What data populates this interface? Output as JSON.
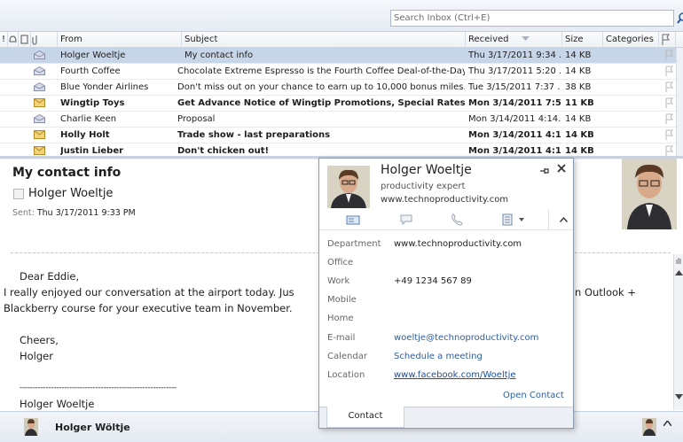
{
  "search": {
    "placeholder": "Search Inbox (Ctrl+E)"
  },
  "columns": {
    "importance": "!",
    "from": "From",
    "subject": "Subject",
    "received": "Received",
    "size": "Size",
    "categories": "Categories"
  },
  "messages": [
    {
      "from": "Holger Woeltje",
      "subject": "My contact info",
      "received": "Thu 3/17/2011 9:34 ...",
      "size": "14 KB",
      "unread": false,
      "selected": true
    },
    {
      "from": "Fourth Coffee",
      "subject": "Chocolate Extreme Espresso is the Fourth Coffee Deal-of-the-Day",
      "received": "Thu 3/17/2011 5:20 ...",
      "size": "14 KB",
      "unread": false,
      "selected": false
    },
    {
      "from": "Blue Yonder Airlines",
      "subject": "Don't miss out on your chance to earn up to 10,000 bonus miles.",
      "received": "Tue 3/15/2011 7:37 ...",
      "size": "38 KB",
      "unread": false,
      "selected": false
    },
    {
      "from": "Wingtip Toys",
      "subject": "Get Advance Notice of Wingtip Promotions, Special Rates, and ...",
      "received": "Mon 3/14/2011 7:5...",
      "size": "11 KB",
      "unread": true,
      "selected": false
    },
    {
      "from": "Charlie Keen",
      "subject": "Proposal",
      "received": "Mon 3/14/2011 4:14...",
      "size": "14 KB",
      "unread": false,
      "selected": false
    },
    {
      "from": "Holly Holt",
      "subject": "Trade show - last preparations",
      "received": "Mon 3/14/2011 4:1...",
      "size": "14 KB",
      "unread": true,
      "selected": false
    },
    {
      "from": "Justin Lieber",
      "subject": "Don't chicken out!",
      "received": "Mon 3/14/2011 4:1...",
      "size": "14 KB",
      "unread": true,
      "selected": false
    }
  ],
  "reading": {
    "title": "My contact info",
    "from": "Holger Woeltje",
    "sent_label": "Sent:",
    "sent_value": "Thu 3/17/2011 9:33 PM",
    "body": {
      "greeting": "Dear Eddie,",
      "line1a": "I really enjoyed our conversation at the airport today. Jus",
      "line1b": "n Outlook +",
      "line2": "Blackberry course for your executive team in November.",
      "closing": "Cheers,",
      "sig": "Holger",
      "dashes": "------------------------------------------------------------",
      "sig_full": "Holger Woeltje"
    }
  },
  "contact_card": {
    "name": "Holger Woeltje",
    "title": "productivity expert",
    "website": "www.technoproductivity.com",
    "fields": [
      {
        "label": "Department",
        "value": "www.technoproductivity.com",
        "style": "plain"
      },
      {
        "label": "Office",
        "value": "",
        "style": "plain"
      },
      {
        "label": "Work",
        "value": "+49 1234 567 89",
        "style": "plain"
      },
      {
        "label": "Mobile",
        "value": "",
        "style": "plain"
      },
      {
        "label": "Home",
        "value": "",
        "style": "plain"
      },
      {
        "label": "E-mail",
        "value": "woeltje@technoproductivity.com",
        "style": "link"
      },
      {
        "label": "Calendar",
        "value": "Schedule a meeting",
        "style": "link"
      },
      {
        "label": "Location",
        "value": "www.facebook.com/Woeltje",
        "style": "ulink"
      }
    ],
    "open_contact": "Open Contact",
    "tab": "Contact"
  },
  "people_pane": {
    "name": "Holger Wöltje"
  },
  "colors": {
    "selected_row": "#c7d5e8",
    "link": "#2a5ea8",
    "envelope_read": "#c9c9d6",
    "envelope_unread": "#e8c45a"
  }
}
